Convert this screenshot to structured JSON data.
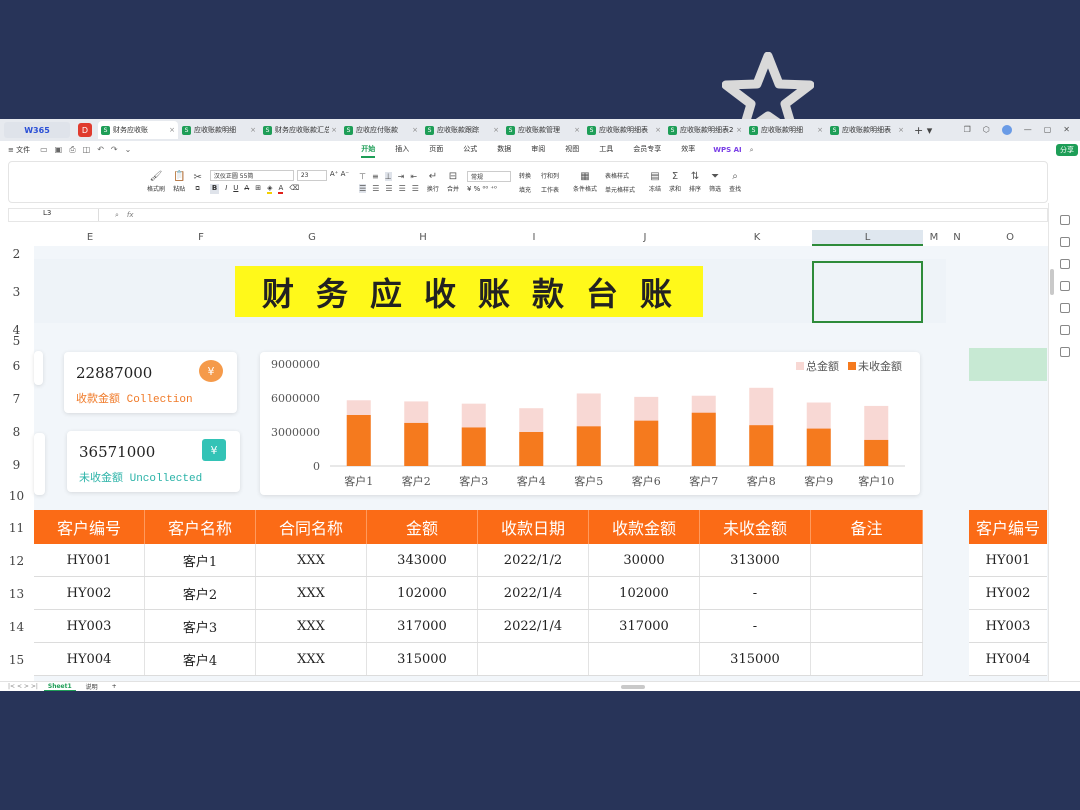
{
  "colors": {
    "background": "#283459",
    "accent_green": "#1e9e57",
    "header_orange": "#fb6b16",
    "bar_total": "#f8d8d4",
    "bar_uncollected": "#f57a1e",
    "title_yellow": "#fff91a"
  },
  "tabbar": {
    "brand": "W365",
    "tabs": [
      {
        "label": "财务应收账"
      },
      {
        "label": "应收账款明细"
      },
      {
        "label": "财务应收账款汇总"
      },
      {
        "label": "应收应付账款"
      },
      {
        "label": "应收账款跟踪"
      },
      {
        "label": "应收账款管理"
      },
      {
        "label": "应收账款明细表"
      },
      {
        "label": "应收账款明细表2"
      },
      {
        "label": "应收账款明细"
      },
      {
        "label": "应收账款明细表"
      }
    ]
  },
  "menubar": {
    "file": "≡ 文件",
    "items": [
      "开始",
      "插入",
      "页面",
      "公式",
      "数据",
      "审阅",
      "视图",
      "工具",
      "会员专享",
      "效率"
    ],
    "wps_ai": "WPS AI",
    "share": "分享"
  },
  "ribbon": {
    "format_painter": "格式刷",
    "paste": "粘贴",
    "font_name": "汉仪正圆 55简",
    "font_size": "23",
    "wrap": "换行",
    "merge": "合并",
    "number_format": "常规",
    "convert": "转换",
    "row_col": "行和列",
    "worksheet": "工作表",
    "cond_format": "条件格式",
    "table_style": "表格样式",
    "cell_style": "单元格样式",
    "sum": "求和",
    "sort": "排序",
    "filter": "筛选",
    "fill": "填充",
    "find": "查找",
    "freeze": "冻结"
  },
  "formula_bar": {
    "cell_ref": "L3",
    "fx": "fx",
    "formula": ""
  },
  "columns": [
    "E",
    "F",
    "G",
    "H",
    "I",
    "J",
    "K",
    "L",
    "M",
    "N",
    "O"
  ],
  "rows": [
    "2",
    "3",
    "4",
    "5",
    "6",
    "7",
    "8",
    "9",
    "10",
    "11",
    "12",
    "13",
    "14",
    "15"
  ],
  "title": "财务应收账款台账",
  "cards": [
    {
      "value": "22887000",
      "label": "收款金额 Collection",
      "label_color": "#f07a28",
      "badge_color": "#f59a4a"
    },
    {
      "value": "36571000",
      "label": "未收金额 Uncollected",
      "label_color": "#2bb3a8",
      "badge_color": "#33c3b6"
    }
  ],
  "chart_data": {
    "type": "bar",
    "categories": [
      "客户1",
      "客户2",
      "客户3",
      "客户4",
      "客户5",
      "客户6",
      "客户7",
      "客户8",
      "客户9",
      "客户10"
    ],
    "series": [
      {
        "name": "总金额",
        "values": [
          5800000,
          5700000,
          5500000,
          5100000,
          6400000,
          6100000,
          6200000,
          6900000,
          5600000,
          5300000
        ]
      },
      {
        "name": "未收金额",
        "values": [
          4500000,
          3800000,
          3400000,
          3000000,
          3500000,
          4000000,
          4700000,
          3600000,
          3300000,
          2300000
        ]
      }
    ],
    "y_ticks": [
      "9000000",
      "6000000",
      "3000000",
      "0"
    ],
    "ylim": [
      0,
      9000000
    ],
    "stacked": false,
    "legend": "top-right"
  },
  "table": {
    "headers": [
      "客户编号",
      "客户名称",
      "合同名称",
      "金额",
      "收款日期",
      "收款金额",
      "未收金额",
      "备注"
    ],
    "rows": [
      [
        "HY001",
        "客户1",
        "XXX",
        "343000",
        "2022/1/2",
        "30000",
        "313000",
        ""
      ],
      [
        "HY002",
        "客户2",
        "XXX",
        "102000",
        "2022/1/4",
        "102000",
        "-",
        ""
      ],
      [
        "HY003",
        "客户3",
        "XXX",
        "317000",
        "2022/1/4",
        "317000",
        "-",
        ""
      ],
      [
        "HY004",
        "客户4",
        "XXX",
        "315000",
        "",
        "",
        "315000",
        ""
      ]
    ],
    "right_header": "客户编号",
    "right_values": [
      "HY001",
      "HY002",
      "HY003",
      "HY004"
    ]
  },
  "sheets": {
    "active": "Sheet1",
    "other": "说明",
    "add": "+"
  }
}
